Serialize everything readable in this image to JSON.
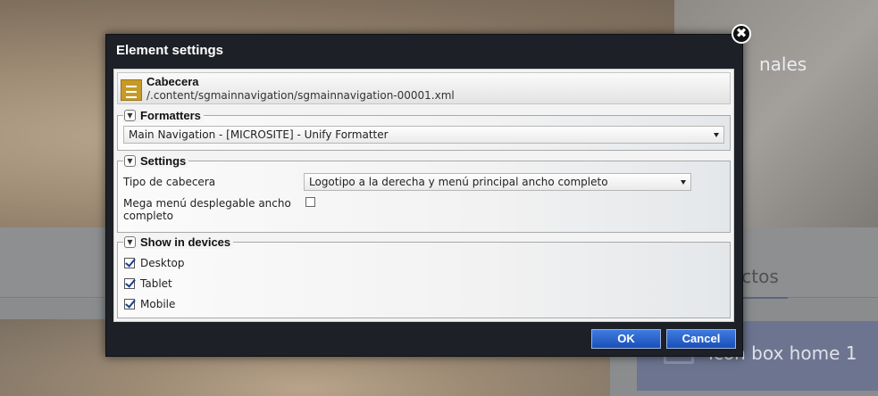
{
  "background": {
    "hero_text": "nales",
    "tab_label": "ectos",
    "box_label": "Icon box home 1"
  },
  "dialog": {
    "title": "Element settings",
    "close_symbol": "✖",
    "header": {
      "title": "Cabecera",
      "path": "/.content/sgmainnavigation/sgmainnavigation-00001.xml",
      "icon": "list-icon"
    },
    "formatters": {
      "legend": "Formatters",
      "selected": "Main Navigation - [MICROSITE] - Unify Formatter"
    },
    "settings": {
      "legend": "Settings",
      "header_type_label": "Tipo de cabecera",
      "header_type_value": "Logotipo a la derecha y menú principal ancho completo",
      "mega_menu_label_line1": "Mega menú desplegable ancho",
      "mega_menu_label_line2": "completo",
      "mega_menu_checked": false
    },
    "devices": {
      "legend": "Show in devices",
      "items": [
        {
          "label": "Desktop",
          "checked": true
        },
        {
          "label": "Tablet",
          "checked": true
        },
        {
          "label": "Mobile",
          "checked": true
        }
      ]
    },
    "ok_label": "OK",
    "cancel_label": "Cancel"
  },
  "colors": {
    "dialog_bg": "#1d2026",
    "button": "#1a4fb8",
    "checkmark": "#1b3d8f"
  }
}
